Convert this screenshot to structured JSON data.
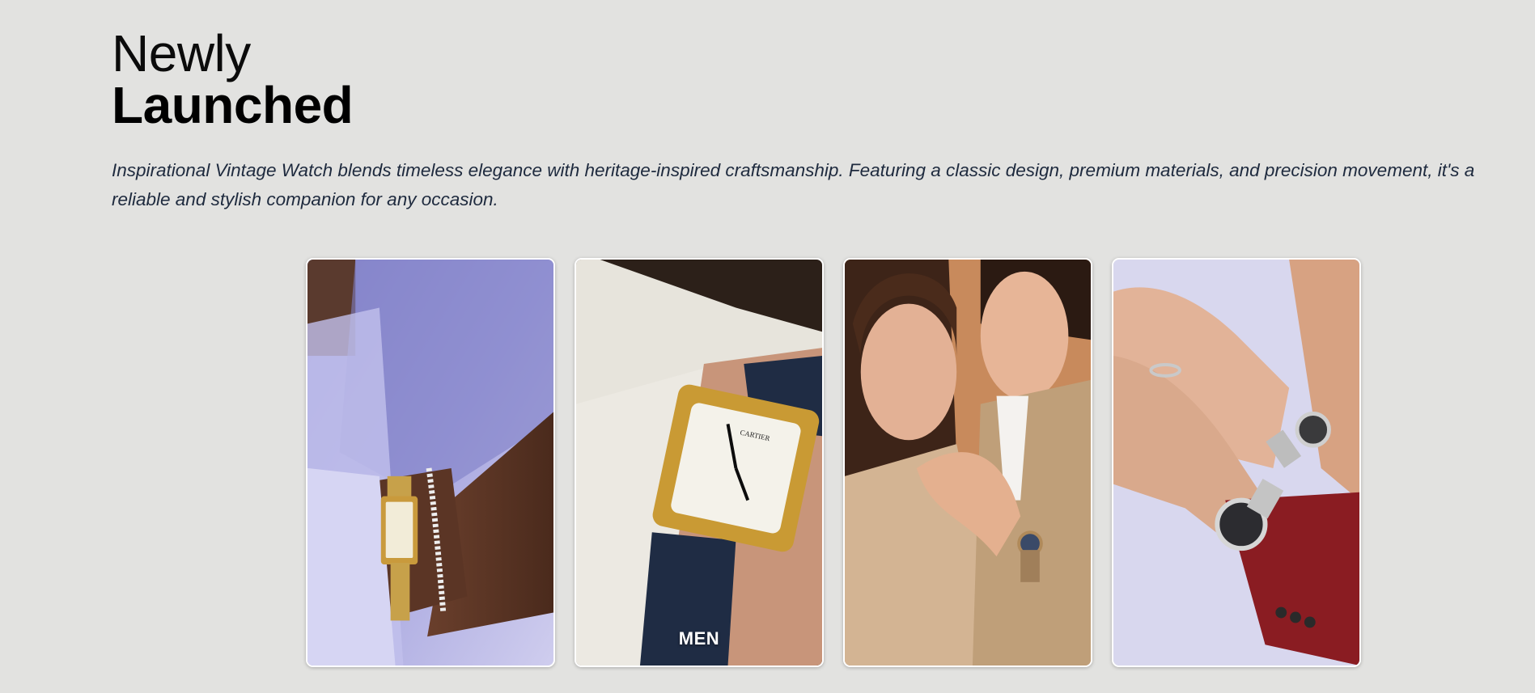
{
  "section": {
    "title_light": "Newly",
    "title_bold": "Launched",
    "description": "Inspirational Vintage Watch blends timeless elegance with heritage-inspired craftsmanship. Featuring a classic design, premium materials, and precision movement, it's a reliable and stylish companion for any occasion."
  },
  "cards": [
    {
      "label": "",
      "image": "gold-rectangular-watch-on-wrist-with-diamond-bracelet"
    },
    {
      "label": "MEN",
      "image": "gold-square-cartier-watch-on-navy-strap"
    },
    {
      "label": "",
      "image": "couple-in-trench-coats-wearing-watch"
    },
    {
      "label": "",
      "image": "hands-with-silver-watches-and-rings"
    }
  ],
  "colors": {
    "background": "#e2e2e0",
    "text": "#000000",
    "description_text": "#1e2a3e",
    "card_border": "#ffffff"
  },
  "watch_dial_text": "CARTIER"
}
